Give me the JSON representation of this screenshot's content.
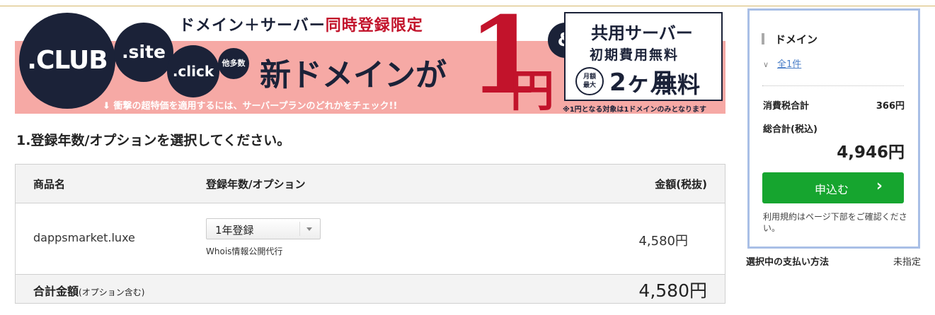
{
  "banner": {
    "tld_club": ".CLUB",
    "tld_site": ".site",
    "tld_click": ".click",
    "tld_more": "他多数",
    "headline_plain": "ドメイン＋サーバー",
    "headline_red": "同時登録限定",
    "main_text": "新ドメインが",
    "price_number": "1",
    "price_unit": "円",
    "note": "衝撃の超特価を適用するには、サーバープランのどれかをチェック!!",
    "amp": "&",
    "server_line1": "共用サーバー",
    "server_line2": "初期費用無料",
    "badge_line1": "月額",
    "badge_line2": "最大",
    "months": "2ヶ月",
    "free": "無料",
    "footnote": "※1円となる対象は1ドメインのみとなります"
  },
  "section_title": "1.登録年数/オプションを選択してください。",
  "table": {
    "headers": {
      "product": "商品名",
      "period": "登録年数/オプション",
      "amount": "金額(税抜)"
    },
    "row": {
      "domain": "dappsmarket.luxe",
      "period_selected": "1年登録",
      "option": "Whois情報公開代行",
      "price": "4,580円"
    },
    "total": {
      "label": "合計金額",
      "label_note": "(オプション含む)",
      "amount": "4,580円"
    }
  },
  "sidebar": {
    "title": "ドメイン",
    "count_link": "全1件",
    "tax_label": "消費税合計",
    "tax_value": "366円",
    "total_label": "総合計(税込)",
    "total_value": "4,946円",
    "apply_label": "申込む",
    "apply_arrow": "›",
    "terms": "利用規約はページ下部をご確認ください。"
  },
  "payment": {
    "label": "選択中の支払い方法",
    "value": "未指定"
  },
  "colors": {
    "accent_green": "#16a52f",
    "banner_navy": "#1b2238",
    "banner_red": "#c2132b",
    "sidebar_border": "#a9bfe6"
  },
  "icons": [
    "down-arrow-icon",
    "chevron-down-icon",
    "select-arrow-icon",
    "chevron-right-icon"
  ]
}
